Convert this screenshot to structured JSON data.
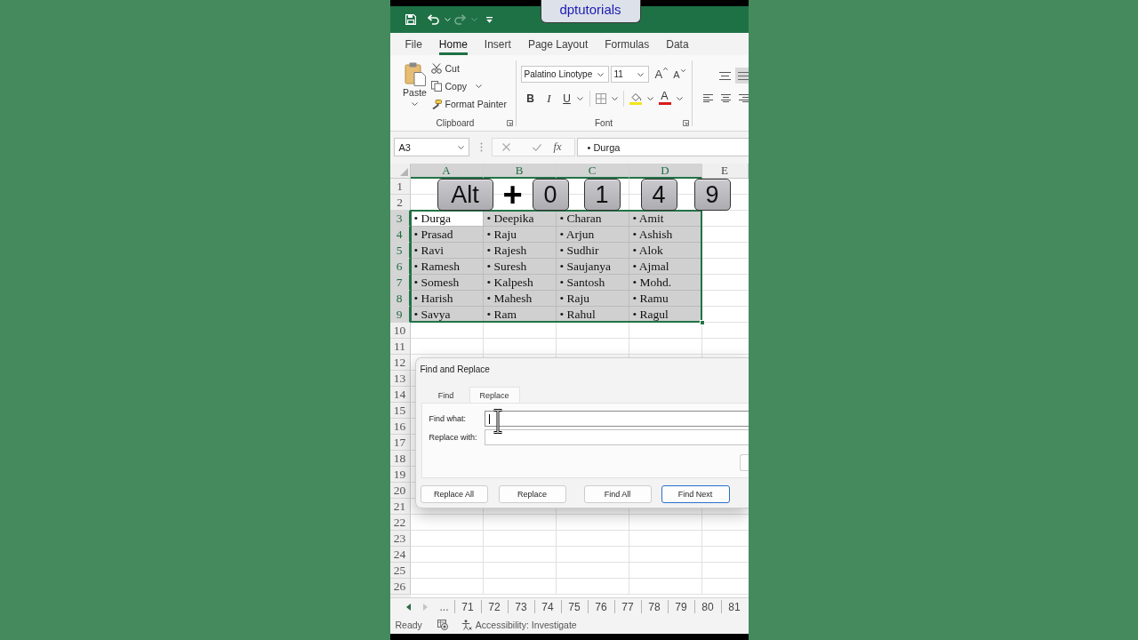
{
  "caption": {
    "text": "dptutorials"
  },
  "quick_access": [
    {
      "kind": "save",
      "disabled": false
    },
    {
      "kind": "undo",
      "disabled": false
    },
    {
      "kind": "redo",
      "disabled": true
    },
    {
      "kind": "customize",
      "disabled": false
    }
  ],
  "ribbon_tabs": [
    {
      "label": "File",
      "selected": false
    },
    {
      "label": "Home",
      "selected": true
    },
    {
      "label": "Insert",
      "selected": false
    },
    {
      "label": "Page Layout",
      "selected": false
    },
    {
      "label": "Formulas",
      "selected": false
    },
    {
      "label": "Data",
      "selected": false
    }
  ],
  "clipboard_group": {
    "paste": "Paste",
    "cut": "Cut",
    "copy": "Copy",
    "format_painter": "Format Painter",
    "label": "Clipboard"
  },
  "font_group": {
    "font_name": "Palatino Linotype",
    "font_size": "11",
    "grow": "A",
    "shrink": "A",
    "bold": "B",
    "italic": "I",
    "underline": "U",
    "font_color": "A",
    "label": "Font"
  },
  "formula_bar": {
    "name_box": "A3",
    "function_button": "fx",
    "content": "• Durga"
  },
  "sheet": {
    "columns": [
      {
        "label": "A",
        "selected": true
      },
      {
        "label": "B",
        "selected": true
      },
      {
        "label": "C",
        "selected": true
      },
      {
        "label": "D",
        "selected": true
      },
      {
        "label": "E",
        "selected": false
      }
    ],
    "rows": [
      {
        "header": "1",
        "selected": false
      },
      {
        "header": "2",
        "selected": false
      },
      {
        "header": "3",
        "selected": true,
        "cells": [
          {
            "text": "• Durga",
            "active": true
          },
          {
            "text": "• Deepika",
            "active": false
          },
          {
            "text": "• Charan",
            "active": false
          },
          {
            "text": "• Amit",
            "active": false
          }
        ]
      },
      {
        "header": "4",
        "selected": true,
        "cells": [
          {
            "text": "• Prasad",
            "active": false
          },
          {
            "text": "• Raju",
            "active": false
          },
          {
            "text": "• Arjun",
            "active": false
          },
          {
            "text": "• Ashish",
            "active": false
          }
        ]
      },
      {
        "header": "5",
        "selected": true,
        "cells": [
          {
            "text": "• Ravi",
            "active": false
          },
          {
            "text": "• Rajesh",
            "active": false
          },
          {
            "text": "• Sudhir",
            "active": false
          },
          {
            "text": "• Alok",
            "active": false
          }
        ]
      },
      {
        "header": "6",
        "selected": true,
        "cells": [
          {
            "text": "• Ramesh",
            "active": false
          },
          {
            "text": "• Suresh",
            "active": false
          },
          {
            "text": "• Saujanya",
            "active": false
          },
          {
            "text": "• Ajmal",
            "active": false
          }
        ]
      },
      {
        "header": "7",
        "selected": true,
        "cells": [
          {
            "text": "• Somesh",
            "active": false
          },
          {
            "text": "• Kalpesh",
            "active": false
          },
          {
            "text": "• Santosh",
            "active": false
          },
          {
            "text": "• Mohd.",
            "active": false
          }
        ]
      },
      {
        "header": "8",
        "selected": true,
        "cells": [
          {
            "text": "• Harish",
            "active": false
          },
          {
            "text": "• Mahesh",
            "active": false
          },
          {
            "text": "• Raju",
            "active": false
          },
          {
            "text": "• Ramu",
            "active": false
          }
        ]
      },
      {
        "header": "9",
        "selected": true,
        "cells": [
          {
            "text": "• Savya",
            "active": false
          },
          {
            "text": "• Ram",
            "active": false
          },
          {
            "text": "• Rahul",
            "active": false
          },
          {
            "text": "• Ragul",
            "active": false
          }
        ]
      },
      {
        "header": "10",
        "selected": false
      },
      {
        "header": "11",
        "selected": false
      },
      {
        "header": "12",
        "selected": false
      },
      {
        "header": "13",
        "selected": false
      },
      {
        "header": "14",
        "selected": false
      },
      {
        "header": "15",
        "selected": false
      },
      {
        "header": "16",
        "selected": false
      },
      {
        "header": "17",
        "selected": false
      },
      {
        "header": "18",
        "selected": false
      },
      {
        "header": "19",
        "selected": false
      },
      {
        "header": "20",
        "selected": false
      },
      {
        "header": "21",
        "selected": false
      },
      {
        "header": "22",
        "selected": false
      },
      {
        "header": "23",
        "selected": false
      },
      {
        "header": "24",
        "selected": false
      },
      {
        "header": "25",
        "selected": false
      },
      {
        "header": "26",
        "selected": false
      }
    ]
  },
  "key_overlay": [
    {
      "kind": "key",
      "label": "Alt"
    },
    {
      "kind": "plus",
      "label": "+"
    },
    {
      "kind": "key",
      "label": "0"
    },
    {
      "kind": "key",
      "label": "1"
    },
    {
      "kind": "key",
      "label": "4"
    },
    {
      "kind": "key",
      "label": "9"
    }
  ],
  "dialog": {
    "title": "Find and Replace",
    "tabs": [
      {
        "label": "Find",
        "selected": false
      },
      {
        "label": "Replace",
        "selected": true
      }
    ],
    "fields": [
      {
        "label": "Find what:",
        "focused": true
      },
      {
        "label": "Replace with:",
        "focused": false
      }
    ],
    "buttons": [
      {
        "label": "Replace All",
        "default": false
      },
      {
        "label": "Replace",
        "default": false
      },
      {
        "label": "Find All",
        "default": false
      },
      {
        "label": "Find Next",
        "default": true
      }
    ]
  },
  "sheet_tabs": {
    "nav": [
      {
        "kind": "prev",
        "disabled": false
      },
      {
        "kind": "next",
        "disabled": true
      }
    ],
    "more": "...",
    "tabs": [
      {
        "label": "71",
        "selected": false
      },
      {
        "label": "72",
        "selected": false
      },
      {
        "label": "73",
        "selected": false
      },
      {
        "label": "74",
        "selected": false
      },
      {
        "label": "75",
        "selected": false
      },
      {
        "label": "76",
        "selected": false
      },
      {
        "label": "77",
        "selected": false
      },
      {
        "label": "78",
        "selected": false
      },
      {
        "label": "79",
        "selected": false
      },
      {
        "label": "80",
        "selected": false
      },
      {
        "label": "81",
        "selected": false
      }
    ]
  },
  "status_bar": {
    "status": "Ready",
    "accessibility": "Accessibility: Investigate"
  }
}
